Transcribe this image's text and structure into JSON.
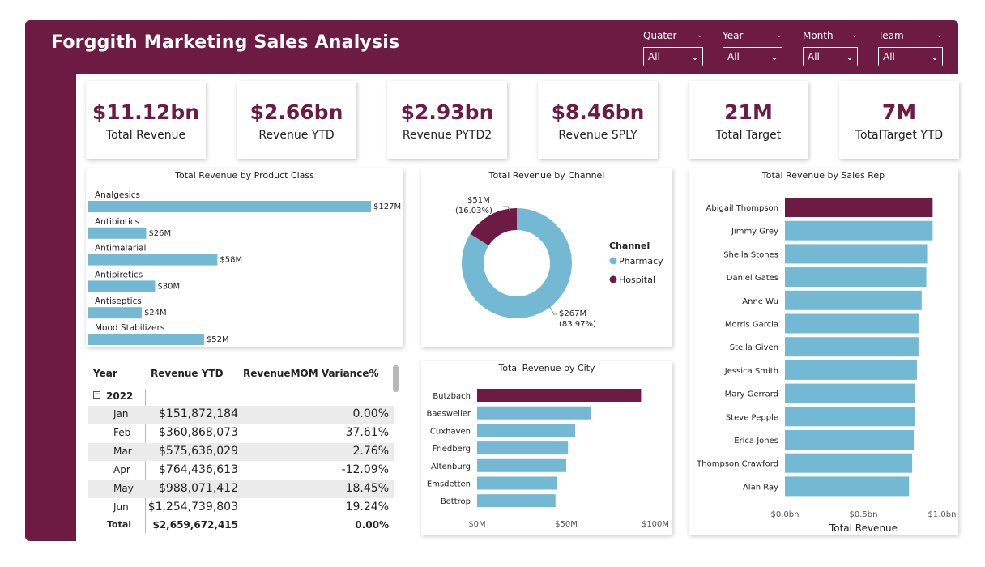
{
  "header": {
    "title": "Forggith Marketing Sales Analysis"
  },
  "slicers": [
    {
      "label": "Quater",
      "value": "All"
    },
    {
      "label": "Year",
      "value": "All"
    },
    {
      "label": "Month",
      "value": "All"
    },
    {
      "label": "Team",
      "value": "All"
    }
  ],
  "kpis": [
    {
      "value": "$11.12bn",
      "label": "Total Revenue"
    },
    {
      "value": "$2.66bn",
      "label": "Revenue YTD"
    },
    {
      "value": "$2.93bn",
      "label": "Revenue PYTD2"
    },
    {
      "value": "$8.46bn",
      "label": "Revenue SPLY"
    },
    {
      "value": "21M",
      "label": "Total Target"
    },
    {
      "value": "7M",
      "label": "TotalTarget YTD"
    }
  ],
  "colors": {
    "brand": "#6d1b42",
    "bar": "#74b9d3"
  },
  "table": {
    "headers": [
      "Year",
      "Revenue YTD",
      "RevenueMOM Variance%"
    ],
    "year_label": "2022",
    "expand_icon": "minus-box-icon",
    "rows": [
      {
        "month": "Jan",
        "revenue": "$151,872,184",
        "variance": "0.00%"
      },
      {
        "month": "Feb",
        "revenue": "$360,868,073",
        "variance": "37.61%"
      },
      {
        "month": "Mar",
        "revenue": "$575,636,029",
        "variance": "2.76%"
      },
      {
        "month": "Apr",
        "revenue": "$764,436,613",
        "variance": "-12.09%"
      },
      {
        "month": "May",
        "revenue": "$988,071,412",
        "variance": "18.45%"
      },
      {
        "month": "Jun",
        "revenue": "$1,254,739,803",
        "variance": "19.24%"
      }
    ],
    "total": {
      "label": "Total",
      "revenue": "$2,659,672,415",
      "variance": "0.00%"
    }
  },
  "chart_data": [
    {
      "type": "bar",
      "title": "Total Revenue by Product Class",
      "categories": [
        "Analgesics",
        "Antibiotics",
        "Antimalarial",
        "Antipiretics",
        "Antiseptics",
        "Mood Stabilizers"
      ],
      "values": [
        127,
        26,
        58,
        30,
        24,
        52
      ],
      "data_labels": [
        "$127M",
        "$26M",
        "$58M",
        "$30M",
        "$24M",
        "$52M"
      ],
      "xmax": 127
    },
    {
      "type": "pie",
      "title": "Total Revenue by Channel",
      "legend_title": "Channel",
      "slices": [
        {
          "name": "Pharmacy",
          "value": 267,
          "label": "$267M",
          "percent": "(83.97%)",
          "color": "#74b9d3"
        },
        {
          "name": "Hospital",
          "value": 51,
          "label": "$51M",
          "percent": "(16.03%)",
          "color": "#6d1b42"
        }
      ]
    },
    {
      "type": "bar",
      "title": "Total Revenue by City",
      "categories": [
        "Butzbach",
        "Baesweiler",
        "Cuxhaven",
        "Friedberg",
        "Altenburg",
        "Emsdetten",
        "Bottrop"
      ],
      "values": [
        92,
        64,
        55,
        51,
        50,
        45,
        44
      ],
      "xlim": [
        0,
        100
      ],
      "xticks": [
        "$0M",
        "$50M",
        "$100M"
      ],
      "highlight_index": 0
    },
    {
      "type": "bar",
      "title": "Total Revenue by Sales Rep",
      "categories": [
        "Abigail Thompson",
        "Jimmy Grey",
        "Sheila Stones",
        "Daniel Gates",
        "Anne Wu",
        "Morris Garcia",
        "Stella Given",
        "Jessica Smith",
        "Mary Gerrard",
        "Steve Pepple",
        "Erica Jones",
        "Thompson Crawford",
        "Alan Ray"
      ],
      "values": [
        0.94,
        0.94,
        0.91,
        0.9,
        0.87,
        0.85,
        0.85,
        0.84,
        0.83,
        0.83,
        0.82,
        0.81,
        0.79
      ],
      "xlim": [
        0,
        1.0
      ],
      "xticks": [
        "$0.0bn",
        "$0.5bn",
        "$1.0bn"
      ],
      "xlabel": "Total Revenue",
      "highlight_index": 0
    }
  ]
}
